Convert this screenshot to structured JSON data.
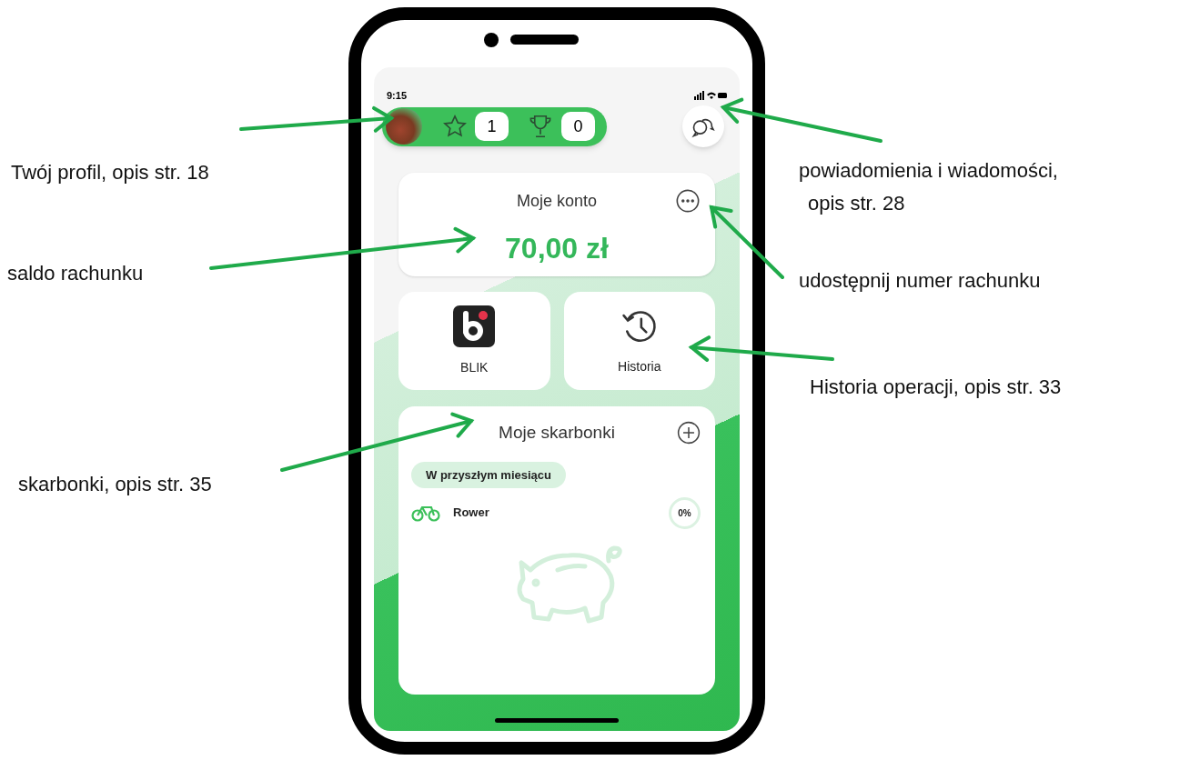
{
  "status_bar": {
    "time": "9:15"
  },
  "profile": {
    "points": "1",
    "trophies": "0"
  },
  "account": {
    "title": "Moje konto",
    "balance": "70,00 zł"
  },
  "tiles": [
    {
      "kind": "blik",
      "label": "BLIK"
    },
    {
      "kind": "history",
      "label": "Historia"
    }
  ],
  "piggy_banks": {
    "title": "Moje skarbonki",
    "filter": "W przyszłym miesiącu",
    "items": [
      {
        "name": "Rower",
        "progress": "0%"
      }
    ]
  },
  "annotations": [
    {
      "lines": [
        "Twój profil, opis str. 18"
      ]
    },
    {
      "lines": [
        "saldo rachunku"
      ]
    },
    {
      "lines": [
        "skarbonki, opis str. 35"
      ]
    },
    {
      "lines": [
        "powiadomienia i wiadomości,",
        "opis str. 28"
      ]
    },
    {
      "lines": [
        "udostępnij numer rachunku"
      ]
    },
    {
      "lines": [
        "Historia operacji, opis str. 33"
      ]
    }
  ]
}
